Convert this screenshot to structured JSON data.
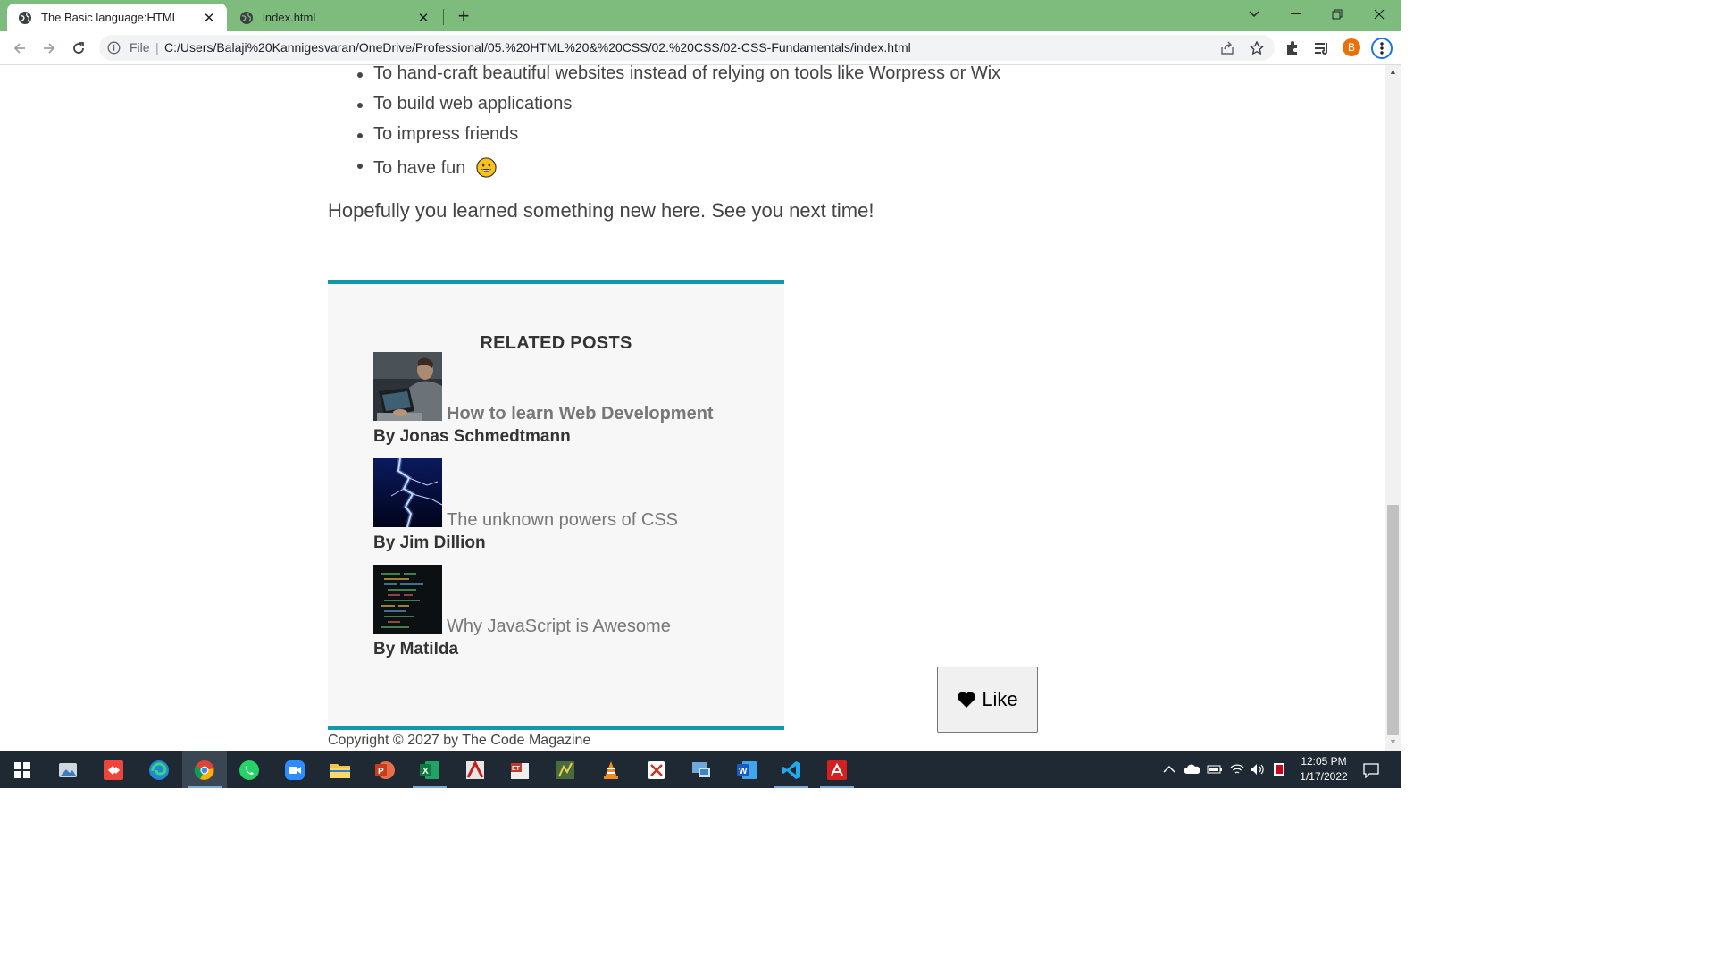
{
  "browser": {
    "tabs": [
      {
        "title": "The Basic language:HTML",
        "active": true
      },
      {
        "title": "index.html",
        "active": false
      }
    ],
    "omnibox": {
      "scheme": "File",
      "url": "C:/Users/Balaji%20Kannigesvaran/OneDrive/Professional/05.%20HTML%20&%20CSS/02.%20CSS/02-CSS-Fundamentals/index.html"
    },
    "profile_initial": "B",
    "accent_color": "#7dbc7d"
  },
  "article": {
    "reasons": [
      "To hand-craft beautiful websites instead of relying on tools like Worpress or Wix",
      "To build web applications",
      "To impress friends",
      "To have fun"
    ],
    "fun_emoji": "grinning-face-emoji",
    "closing": "Hopefully you learned something new here. See you next time!"
  },
  "related": {
    "heading": "RELATED POSTS",
    "accent_color": "#1098ad",
    "posts": [
      {
        "title": "How to learn Web Development",
        "author": "By Jonas Schmedtmann",
        "thumb": "person-laptop-photo"
      },
      {
        "title": "The unknown powers of CSS",
        "author": "By Jim Dillion",
        "thumb": "lightning-photo"
      },
      {
        "title": "Why JavaScript is Awesome",
        "author": "By Matilda",
        "thumb": "code-screen-photo"
      }
    ]
  },
  "footer": {
    "copyright": "Copyright © 2027 by The Code Magazine"
  },
  "like_button": {
    "label": "Like",
    "icon": "heart-icon"
  },
  "taskbar": {
    "apps": [
      "start",
      "photos",
      "anydesk",
      "edge",
      "chrome",
      "whatsapp",
      "zoom",
      "file-explorer",
      "powerpoint",
      "excel",
      "acrobat-reader",
      "ettercap",
      "network-tool",
      "vlc",
      "tool",
      "remote-desktop",
      "word",
      "vscode",
      "acrobat"
    ],
    "clock_time": "12:05 PM",
    "clock_date": "1/17/2022"
  }
}
